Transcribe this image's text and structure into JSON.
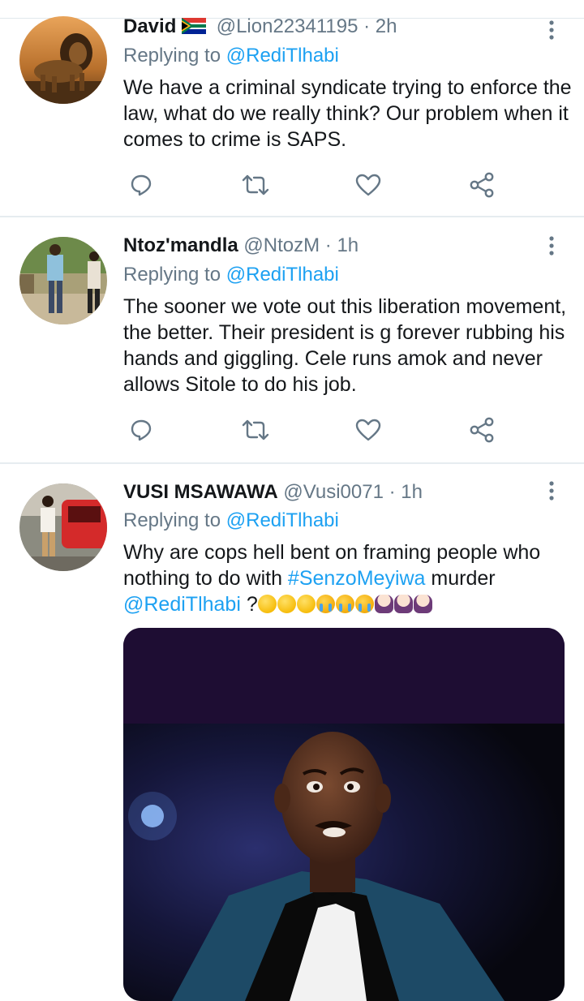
{
  "tweets": [
    {
      "name": "David",
      "handle": "@Lion22341195",
      "time": "2h",
      "replying_prefix": "Replying to",
      "replying_to": "@RediTlhabi",
      "text": "We have a criminal syndicate trying to enforce the law, what do we really think? Our problem when it comes to crime is SAPS."
    },
    {
      "name": "Ntoz'mandla",
      "handle": "@NtozM",
      "time": "1h",
      "replying_prefix": "Replying to",
      "replying_to": "@RediTlhabi",
      "text": "The sooner we vote out this liberation movement, the better. Their president is g forever rubbing his hands and giggling. Cele runs amok and never allows Sitole to do his job."
    },
    {
      "name": "VUSI MSAWAWA",
      "handle": "@Vusi0071",
      "time": "1h",
      "replying_prefix": "Replying to",
      "replying_to": "@RediTlhabi",
      "text_before": "Why are cops hell bent on framing people who nothing to do with ",
      "hashtag": "#SenzoMeyiwa",
      "text_after": " murder",
      "mention": "@RediTlhabi",
      "text_tail": " ?"
    }
  ],
  "separator": "·",
  "icons": {
    "reply": "reply-icon",
    "retweet": "retweet-icon",
    "like": "heart-icon",
    "share": "share-icon",
    "more": "more-vertical-icon"
  },
  "colors": {
    "link": "#1da1f2",
    "secondary_text": "#657786",
    "icon": "#657786",
    "divider": "#e6ecf0"
  }
}
